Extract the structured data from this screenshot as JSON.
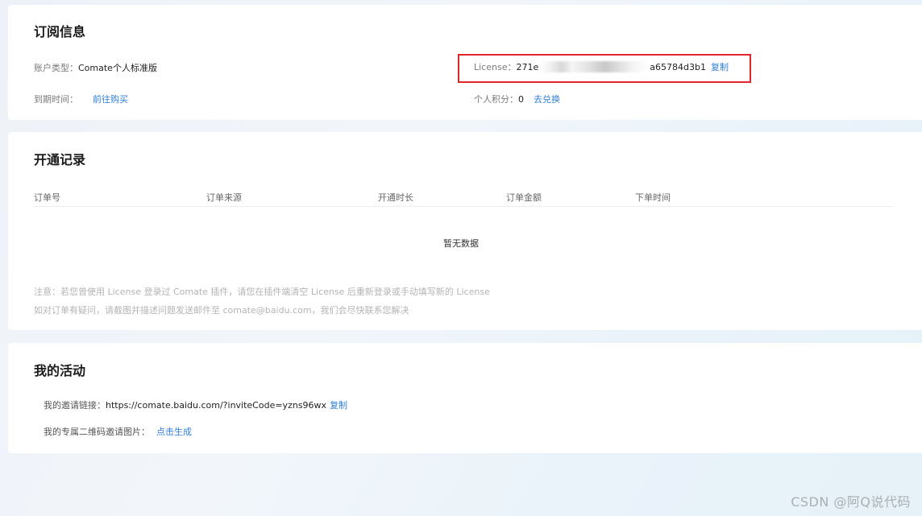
{
  "subscription": {
    "title": "订阅信息",
    "account_type_label": "账户类型：",
    "account_type_value": "Comate个人标准版",
    "expiry_label": "到期时间：",
    "expiry_link": "前往购买",
    "license_label": "License：",
    "license_prefix": "271e",
    "license_suffix": "a65784d3b1",
    "license_copy": "复制",
    "points_label": "个人积分：",
    "points_value": "0",
    "points_link": "去兑换"
  },
  "records": {
    "title": "开通记录",
    "columns": [
      "订单号",
      "订单来源",
      "开通时长",
      "订单金额",
      "下单时间"
    ],
    "empty_text": "暂无数据",
    "note_1": "注意：若您曾使用 License 登录过 Comate 插件，请您在插件端清空 License 后重新登录或手动填写新的 License",
    "note_2": "如对订单有疑问，请截图并描述问题发送邮件至 comate@baidu.com，我们会尽快联系您解决"
  },
  "activity": {
    "title": "我的活动",
    "invite_label": "我的邀请链接：",
    "invite_url": "https://comate.baidu.com/?inviteCode=yzns96wx",
    "invite_copy": "复制",
    "qr_label": "我的专属二维码邀请图片：",
    "qr_link": "点击生成"
  },
  "watermark": "CSDN @阿Q说代码"
}
